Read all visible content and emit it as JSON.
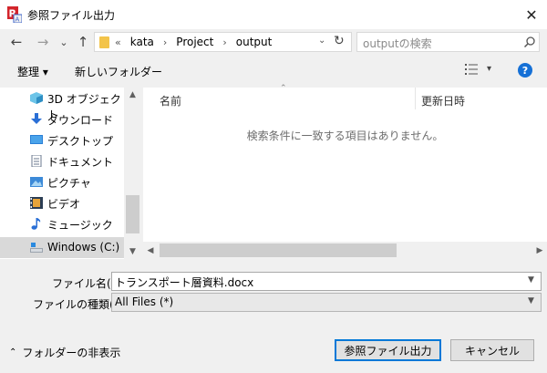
{
  "window": {
    "title": "参照ファイル出力",
    "close_glyph": "✕"
  },
  "nav": {
    "back_glyph": "←",
    "forward_glyph": "→",
    "recent_glyph": "⌄",
    "up_glyph": "↑",
    "overflow": "«",
    "breadcrumbs": [
      "kata",
      "Project",
      "output"
    ],
    "crumb_sep": "›",
    "dropdown_glyph": "⌄",
    "refresh_glyph": "↻"
  },
  "search": {
    "placeholder": "outputの検索"
  },
  "toolbar": {
    "organize": "整理 ▾",
    "new_folder": "新しいフォルダー",
    "view_dd": "▾",
    "help": "?"
  },
  "sidebar": {
    "items": [
      {
        "label": "3D オブジェクト",
        "icon": "cube-icon"
      },
      {
        "label": "ダウンロード",
        "icon": "download-icon"
      },
      {
        "label": "デスクトップ",
        "icon": "desktop-icon"
      },
      {
        "label": "ドキュメント",
        "icon": "document-icon"
      },
      {
        "label": "ピクチャ",
        "icon": "picture-icon"
      },
      {
        "label": "ビデオ",
        "icon": "video-icon"
      },
      {
        "label": "ミュージック",
        "icon": "music-icon"
      },
      {
        "label": "Windows (C:)",
        "icon": "drive-icon",
        "selected": true
      }
    ],
    "scroll_up": "▲",
    "scroll_down": "▼"
  },
  "file_list": {
    "columns": [
      "名前",
      "更新日時"
    ],
    "sort_glyph": "⌃",
    "empty_message": "検索条件に一致する項目はありません。",
    "scroll_left": "◀",
    "scroll_right": "▶"
  },
  "form": {
    "filename_label": "ファイル名(N):",
    "filename_value": "トランスポート層資料.docx",
    "filetype_label": "ファイルの種類(T):",
    "filetype_value": "All Files  (*)",
    "dd_glyph": "▼"
  },
  "footer": {
    "hide_folders": "フォルダーの非表示",
    "hide_glyph": "⌃",
    "primary_button": "参照ファイル出力",
    "cancel_button": "キャンセル"
  },
  "colors": {
    "accent": "#0078d7",
    "selection": "#d9d9d9",
    "help": "#1570d6",
    "app_icon": "#d3242b"
  }
}
